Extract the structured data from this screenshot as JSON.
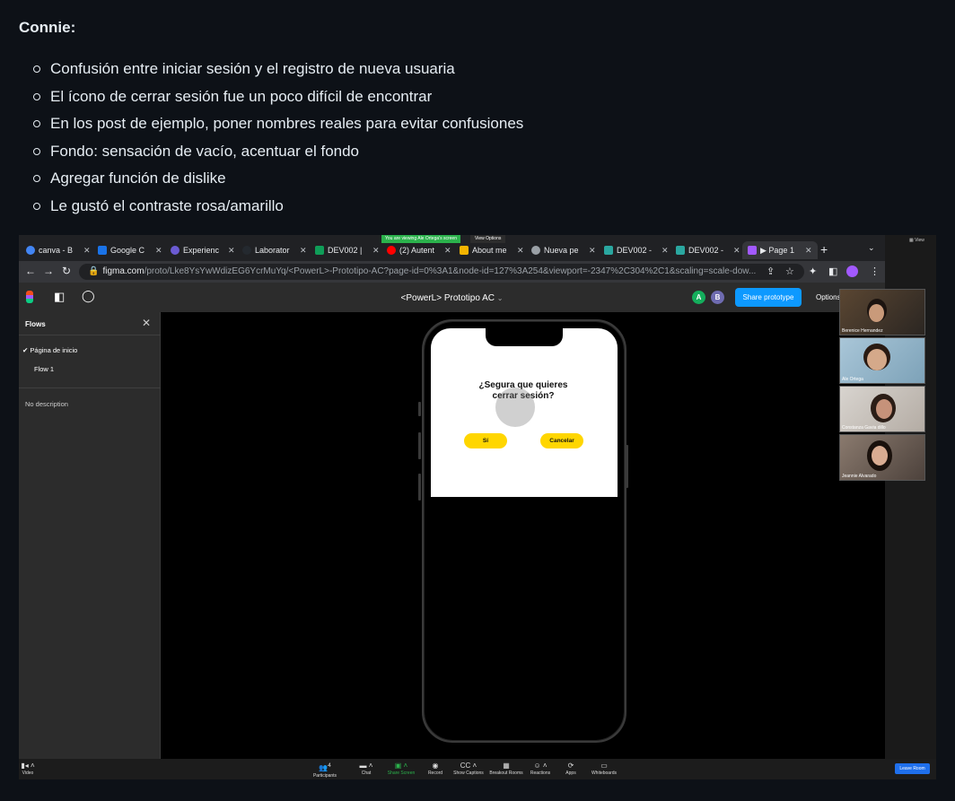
{
  "heading": "Connie:",
  "notes": [
    "Confusión entre iniciar sesión y el registro de nueva usuaria",
    "El ícono de cerrar sesión fue un poco difícil de encontrar",
    "En los post de ejemplo, poner nombres reales para evitar confusiones",
    "Fondo: sensación de vacío, acentuar el fondo",
    "Agregar función de dislike",
    "Le gustó el contraste rosa/amarillo"
  ],
  "zoom": {
    "banner": "You are viewing Ale Ortega's screen",
    "view_options": "View Options",
    "gallery_toggle": "View",
    "toolbar": {
      "video": "Video",
      "participants": "Participants",
      "participants_count": "4",
      "chat": "Chat",
      "share_screen": "Share Screen",
      "record": "Record",
      "captions": "Show Captions",
      "breakout": "Breakout Rooms",
      "reactions": "Reactions",
      "apps": "Apps",
      "whiteboards": "Whiteboards",
      "leave": "Leave Room"
    },
    "participants": [
      "Berenice Hernandez",
      "Ale Ortega",
      "Constanza Gavia dillo",
      "Jeannie Alvarado"
    ]
  },
  "browser": {
    "tabs": [
      {
        "label": "canva - B",
        "icon": "google-icon",
        "color": "#4285f4"
      },
      {
        "label": "Google C",
        "icon": "calendar-icon",
        "color": "#1a73e8"
      },
      {
        "label": "Experienc",
        "icon": "app-icon",
        "color": "#6b5bd3"
      },
      {
        "label": "Laborator",
        "icon": "github-icon",
        "color": "#24292f"
      },
      {
        "label": "DEV002 |",
        "icon": "sheets-icon",
        "color": "#0f9d58"
      },
      {
        "label": "(2) Autent",
        "icon": "youtube-icon",
        "color": "#ff0000"
      },
      {
        "label": "About me",
        "icon": "slides-icon",
        "color": "#f4b400"
      },
      {
        "label": "Nueva pe",
        "icon": "globe-icon",
        "color": "#9aa0a6"
      },
      {
        "label": "DEV002 -",
        "icon": "doc-icon",
        "color": "#2aa7a0"
      },
      {
        "label": "DEV002 -",
        "icon": "doc-icon",
        "color": "#2aa7a0"
      },
      {
        "label": "▶ Page 1",
        "icon": "figma-icon",
        "color": "#a259ff"
      }
    ],
    "url_host": "figma.com",
    "url_path": "/proto/Lke8YsYwWdizEG6YcrMuYq/<PowerL>-Prototipo-AC?page-id=0%3A1&node-id=127%3A254&viewport=-2347%2C304%2C1&scaling=scale-dow..."
  },
  "figma": {
    "title": "<PowerL> Prototipo AC",
    "avatars": [
      "A",
      "B"
    ],
    "share_label": "Share prototype",
    "options_label": "Options",
    "sidebar": {
      "title": "Flows",
      "items": [
        "Página de inicio",
        "Flow 1"
      ],
      "description": "No description"
    },
    "dialog": {
      "question": "¿Segura que quieres cerrar sesión?",
      "yes": "Sí",
      "cancel": "Cancelar"
    }
  },
  "colors": {
    "accent_yellow": "#ffd600",
    "figma_blue": "#0d99ff",
    "zoom_green": "#2bb24c",
    "leave_blue": "#1f6feb"
  }
}
